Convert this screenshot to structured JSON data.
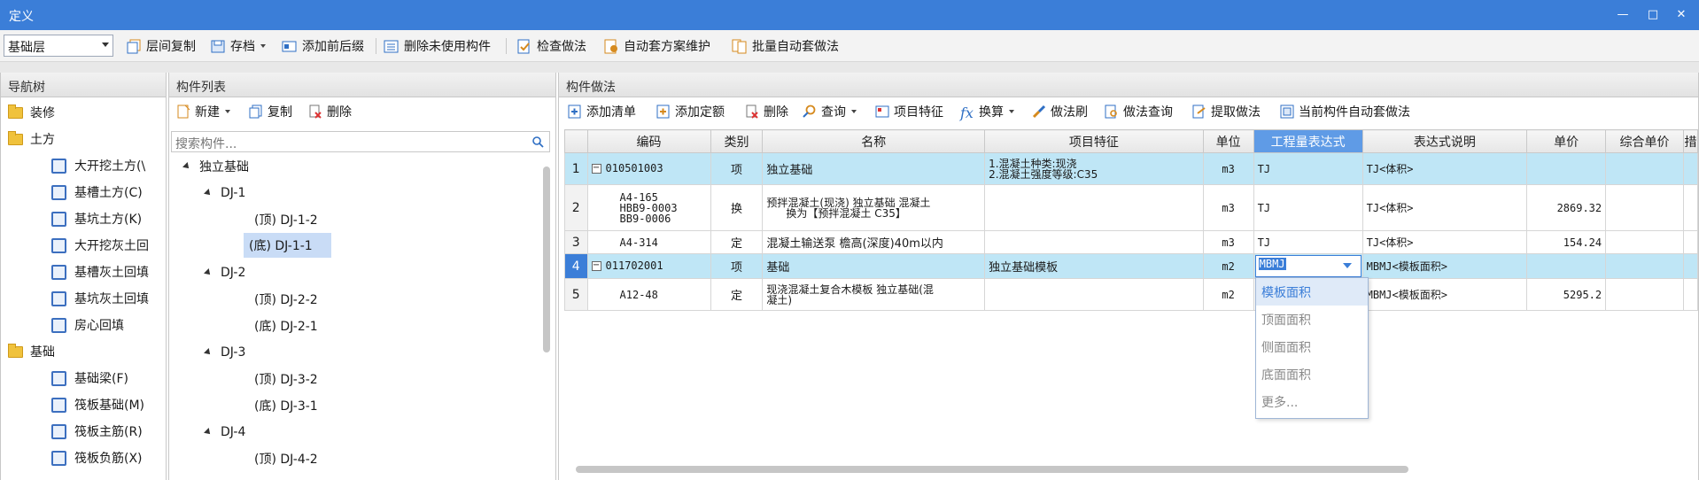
{
  "window": {
    "title": "定义"
  },
  "toolbar": {
    "floor": "基础层",
    "buttons": [
      "层间复制",
      "存档",
      "添加前后缀",
      "删除未使用构件",
      "检查做法",
      "自动套方案维护",
      "批量自动套做法"
    ]
  },
  "nav": {
    "title": "导航树",
    "items": [
      {
        "label": "装修",
        "type": "folder"
      },
      {
        "label": "土方",
        "type": "folder"
      },
      {
        "label": "大开挖土方(\\",
        "type": "item"
      },
      {
        "label": "基槽土方(C)",
        "type": "item"
      },
      {
        "label": "基坑土方(K)",
        "type": "item"
      },
      {
        "label": "大开挖灰土回",
        "type": "item"
      },
      {
        "label": "基槽灰土回填",
        "type": "item"
      },
      {
        "label": "基坑灰土回填",
        "type": "item"
      },
      {
        "label": "房心回填",
        "type": "item"
      },
      {
        "label": "基础",
        "type": "folder"
      },
      {
        "label": "基础梁(F)",
        "type": "item"
      },
      {
        "label": "筏板基础(M)",
        "type": "item"
      },
      {
        "label": "筏板主筋(R)",
        "type": "item"
      },
      {
        "label": "筏板负筋(X)",
        "type": "item"
      }
    ]
  },
  "components": {
    "title": "构件列表",
    "new": "新建",
    "copy": "复制",
    "delete": "删除",
    "search_placeholder": "搜索构件...",
    "tree": [
      {
        "label": "独立基础",
        "level": 0
      },
      {
        "label": "DJ-1",
        "level": 1
      },
      {
        "label": "(顶) DJ-1-2",
        "level": 2
      },
      {
        "label": "(底) DJ-1-1",
        "level": 2,
        "selected": true
      },
      {
        "label": "DJ-2",
        "level": 1
      },
      {
        "label": "(顶) DJ-2-2",
        "level": 2
      },
      {
        "label": "(底) DJ-2-1",
        "level": 2
      },
      {
        "label": "DJ-3",
        "level": 1
      },
      {
        "label": "(顶) DJ-3-2",
        "level": 2
      },
      {
        "label": "(底) DJ-3-1",
        "level": 2
      },
      {
        "label": "DJ-4",
        "level": 1
      },
      {
        "label": "(顶) DJ-4-2",
        "level": 2
      }
    ]
  },
  "method": {
    "title": "构件做法",
    "toolbar": [
      "添加清单",
      "添加定额",
      "删除",
      "查询",
      "项目特征",
      "换算",
      "做法刷",
      "做法查询",
      "提取做法",
      "当前构件自动套做法"
    ],
    "columns": [
      "编码",
      "类别",
      "名称",
      "项目特征",
      "单位",
      "工程量表达式",
      "表达式说明",
      "单价",
      "综合单价",
      "措"
    ],
    "rows": [
      {
        "n": "1",
        "code": "010501003",
        "cat": "项",
        "name": "独立基础",
        "feature1": "1.混凝土种类:现浇",
        "feature2": "2.混凝土强度等级:C35",
        "unit": "m3",
        "expr": "TJ",
        "desc": "TJ<体积>",
        "price": ""
      },
      {
        "n": "2",
        "code1": "A4-165",
        "code2": "HBB9-0003",
        "code3": "BB9-0006",
        "cat": "换",
        "name1": "预拌混凝土(现浇) 独立基础 混凝土",
        "name2": "换为【预拌混凝土 C35】",
        "unit": "m3",
        "expr": "TJ",
        "desc": "TJ<体积>",
        "price": "2869.32"
      },
      {
        "n": "3",
        "code": "A4-314",
        "cat": "定",
        "name": "混凝土输送泵 檐高(深度)40m以内",
        "unit": "m3",
        "expr": "TJ",
        "desc": "TJ<体积>",
        "price": "154.24"
      },
      {
        "n": "4",
        "code": "011702001",
        "cat": "项",
        "name": "基础",
        "feature": "独立基础模板",
        "unit": "m2",
        "expr": "MBMJ",
        "desc": "MBMJ<模板面积>",
        "price": ""
      },
      {
        "n": "5",
        "code": "A12-48",
        "cat": "定",
        "name1": "现浇混凝土复合木模板 独立基础(混",
        "name2": "凝土)",
        "unit": "m2",
        "expr": "",
        "desc": "MBMJ<模板面积>",
        "price": "5295.2"
      }
    ],
    "dropdown": [
      "模板面积",
      "顶面面积",
      "侧面面积",
      "底面面积",
      "更多..."
    ]
  },
  "colors": {
    "titlebar": "#3b7ed8",
    "highlight_row": "#bfe6f6",
    "active_header": "#5f9be6"
  }
}
